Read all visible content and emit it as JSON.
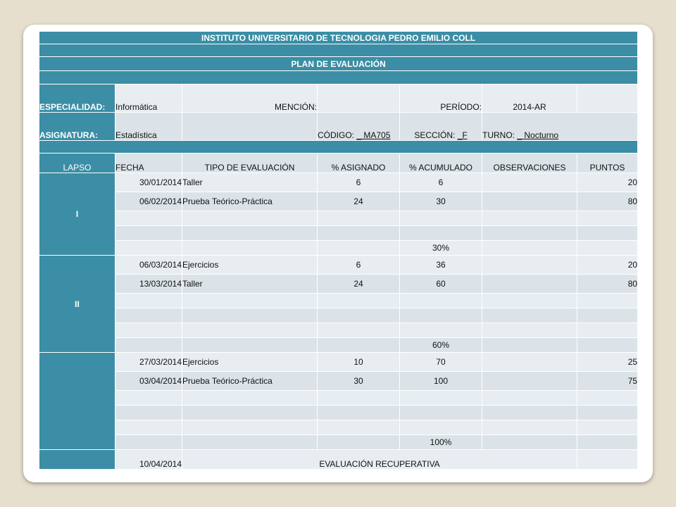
{
  "header": {
    "institute": "INSTITUTO UNIVERSITARIO DE TECNOLOGIA PEDRO EMILIO COLL",
    "plan_title": "PLAN DE EVALUACIÓN"
  },
  "info": {
    "especialidad_label": "ESPECIALIDAD:",
    "especialidad_value": "Informática",
    "mencion_label": "MENCIÓN:",
    "periodo_label": "PERÍODO:",
    "periodo_value": "2014-AR",
    "asignatura_label": "ASIGNATURA:",
    "asignatura_value": "Estadística",
    "codigo_label": "CÓDIGO:",
    "codigo_value": "_ MA705",
    "seccion_label": "SECCIÓN:",
    "seccion_value": "_F",
    "turno_label": "TURNO:",
    "turno_value": "_ Nocturno"
  },
  "columns": [
    "LAPSO",
    "FECHA",
    "TIPO DE EVALUACIÓN",
    "% ASIGNADO",
    "% ACUMULADO",
    "OBSERVACIONES",
    "PUNTOS"
  ],
  "lapsos": [
    {
      "label": "I",
      "rows": [
        {
          "fecha": "30/01/2014",
          "tipo": "Taller",
          "asignado": "6",
          "acumulado": "6",
          "obs": "",
          "puntos": "20"
        },
        {
          "fecha": "06/02/2014",
          "tipo": "Prueba Teórico-Práctica",
          "asignado": "24",
          "acumulado": "30",
          "obs": "",
          "puntos": "80"
        },
        {
          "fecha": "",
          "tipo": "",
          "asignado": "",
          "acumulado": "",
          "obs": "",
          "puntos": ""
        },
        {
          "fecha": "",
          "tipo": "",
          "asignado": "",
          "acumulado": "",
          "obs": "",
          "puntos": ""
        },
        {
          "fecha": "",
          "tipo": "",
          "asignado": "",
          "acumulado": "30%",
          "obs": "",
          "puntos": ""
        }
      ]
    },
    {
      "label": "II",
      "rows": [
        {
          "fecha": "06/03/2014",
          "tipo": "Ejercicios",
          "asignado": "6",
          "acumulado": "36",
          "obs": "",
          "puntos": "20"
        },
        {
          "fecha": "13/03/2014",
          "tipo": "Taller",
          "asignado": "24",
          "acumulado": "60",
          "obs": "",
          "puntos": "80"
        },
        {
          "fecha": "",
          "tipo": "",
          "asignado": "",
          "acumulado": "",
          "obs": "",
          "puntos": ""
        },
        {
          "fecha": "",
          "tipo": "",
          "asignado": "",
          "acumulado": "",
          "obs": "",
          "puntos": ""
        },
        {
          "fecha": "",
          "tipo": "",
          "asignado": "",
          "acumulado": "",
          "obs": "",
          "puntos": ""
        },
        {
          "fecha": "",
          "tipo": "",
          "asignado": "",
          "acumulado": "60%",
          "obs": "",
          "puntos": ""
        }
      ]
    },
    {
      "label": "",
      "rows": [
        {
          "fecha": "27/03/2014",
          "tipo": "Ejercicios",
          "asignado": "10",
          "acumulado": "70",
          "obs": "",
          "puntos": "25"
        },
        {
          "fecha": "03/04/2014",
          "tipo": "Prueba Teórico-Práctica",
          "asignado": "30",
          "acumulado": "100",
          "obs": "",
          "puntos": "75"
        },
        {
          "fecha": "",
          "tipo": "",
          "asignado": "",
          "acumulado": "",
          "obs": "",
          "puntos": ""
        },
        {
          "fecha": "",
          "tipo": "",
          "asignado": "",
          "acumulado": "",
          "obs": "",
          "puntos": ""
        },
        {
          "fecha": "",
          "tipo": "",
          "asignado": "",
          "acumulado": "",
          "obs": "",
          "puntos": ""
        },
        {
          "fecha": "",
          "tipo": "",
          "asignado": "",
          "acumulado": "100%",
          "obs": "",
          "puntos": ""
        }
      ]
    }
  ],
  "recuperativa": {
    "fecha": "10/04/2014",
    "label": "EVALUACIÓN RECUPERATIVA"
  }
}
